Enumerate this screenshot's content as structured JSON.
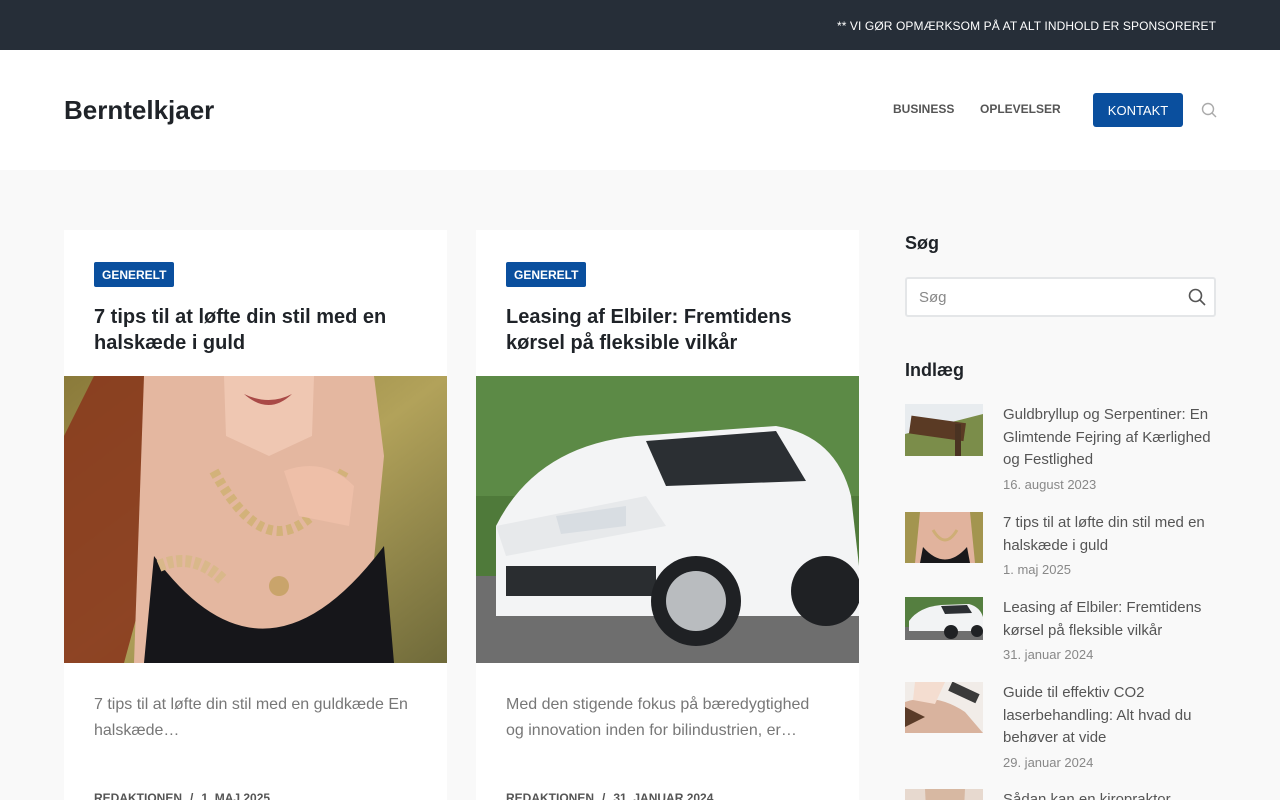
{
  "topbar": {
    "notice": "** VI GØR OPMÆRKSOM PÅ AT ALT INDHOLD ER SPONSORERET"
  },
  "header": {
    "site_title": "Berntelkjaer",
    "nav": {
      "business": "BUSINESS",
      "oplevelser": "OPLEVELSER",
      "kontakt": "KONTAKT"
    },
    "search_icon": "search-icon"
  },
  "cards": [
    {
      "category": "GENERELT",
      "title": "7 tips til at løfte din stil med en halskæde i guld",
      "excerpt": "7 tips til at løfte din stil med en guldkæde En halskæde…",
      "author": "REDAKTIONEN",
      "date": "1. MAJ 2025",
      "image": "woman-gold-necklace-photo"
    },
    {
      "category": "GENERELT",
      "title": "Leasing af Elbiler: Fremtidens kørsel på fleksible vilkår",
      "excerpt": "Med den stigende fokus på bæredygtighed og innovation inden for bilindustrien, er…",
      "author": "REDAKTIONEN",
      "date": "31. JANUAR 2024",
      "image": "white-suv-photo"
    }
  ],
  "sidebar": {
    "search_title": "Søg",
    "search_placeholder": "Søg",
    "posts_title": "Indlæg",
    "posts": [
      {
        "title": "Guldbryllup og Serpentiner: En Glimtende Fejring af Kærlighed og Festlighed",
        "date": "16. august 2023",
        "thumb": "sign-on-tree-thumb"
      },
      {
        "title": "7 tips til at løfte din stil med en halskæde i guld",
        "date": "1. maj 2025",
        "thumb": "necklace-thumb"
      },
      {
        "title": "Leasing af Elbiler: Fremtidens kørsel på fleksible vilkår",
        "date": "31. januar 2024",
        "thumb": "white-car-thumb"
      },
      {
        "title": "Guide til effektiv CO2 laserbehandling: Alt hvad du behøver at vide",
        "date": "29. januar 2024",
        "thumb": "facial-treatment-thumb"
      },
      {
        "title": "Sådan kan en kiropraktor",
        "date": "",
        "thumb": "chiropractor-thumb"
      }
    ]
  },
  "colors": {
    "topbar": "#262e38",
    "accent": "#0a4f9e",
    "page_bg": "#f9f9f9"
  }
}
